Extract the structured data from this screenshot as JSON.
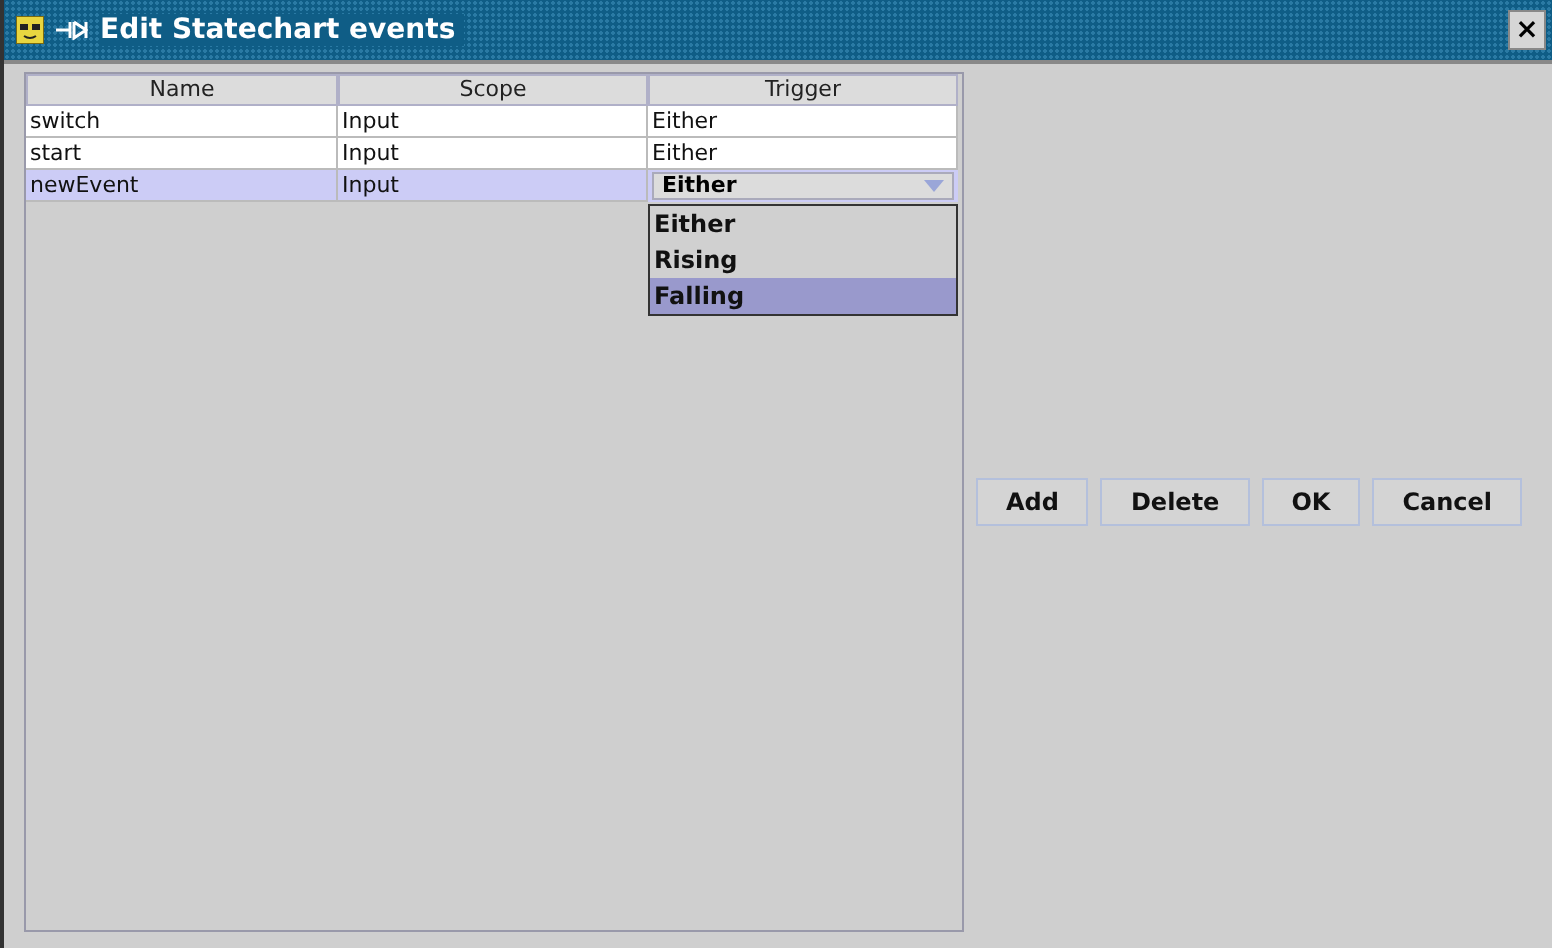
{
  "window": {
    "title": "Edit Statechart events",
    "close": "×"
  },
  "table": {
    "columns": [
      "Name",
      "Scope",
      "Trigger"
    ],
    "rows": [
      {
        "cells": [
          "switch",
          "Input",
          "Either"
        ],
        "selected": false,
        "editing": false
      },
      {
        "cells": [
          "start",
          "Input",
          "Either"
        ],
        "selected": false,
        "editing": false
      },
      {
        "cells": [
          "newEvent",
          "Input",
          "Either"
        ],
        "selected": true,
        "editing": true
      }
    ]
  },
  "dropdown": {
    "options": [
      {
        "label": "Either",
        "selected": false
      },
      {
        "label": "Rising",
        "selected": false
      },
      {
        "label": "Falling",
        "selected": true
      }
    ]
  },
  "buttons": [
    "Add",
    "Delete",
    "OK",
    "Cancel"
  ]
}
